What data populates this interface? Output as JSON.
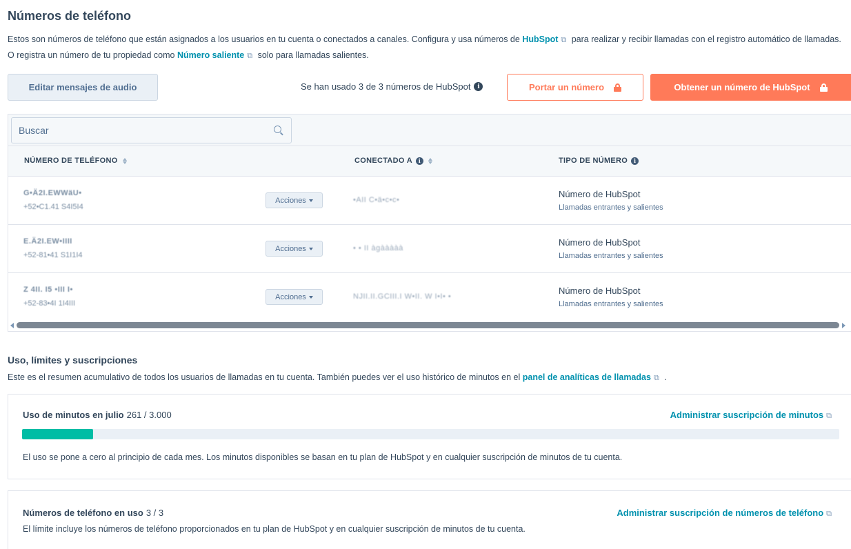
{
  "header": {
    "title": "Números de teléfono",
    "intro_part1": "Estos son números de teléfono que están asignados a los usuarios en tu cuenta o conectados a canales. Configura y usa números de ",
    "intro_link1": "HubSpot",
    "intro_part2": " para realizar y recibir llamadas con el registro automático de llamadas. O registra un número de tu propiedad como ",
    "intro_link2": "Número saliente",
    "intro_part3": " solo para llamadas salientes."
  },
  "toolbar": {
    "edit_audio_label": "Editar mensajes de audio",
    "usage_note": "Se han usado 3 de 3 números de HubSpot",
    "port_number_label": "Portar un número",
    "get_number_label": "Obtener un número de HubSpot"
  },
  "search": {
    "placeholder": "Buscar",
    "value": ""
  },
  "table": {
    "columns": {
      "phone_number": "NÚMERO DE TELÉFONO",
      "connected_to": "CONECTADO A",
      "number_type": "TIPO DE NÚMERO"
    },
    "actions_label": "Acciones",
    "rows": [
      {
        "name": "G•Ä2I.EWWäU•",
        "number": "+52•C1.41 S4I5I4",
        "connected": "•AII C•ä•c•c•",
        "type": "Número de HubSpot",
        "type_sub": "Llamadas entrantes y salientes"
      },
      {
        "name": "E.Ä2I.EW•IIII",
        "number": "+52-81•41 S1I1I4",
        "connected": "• • II àgààààà",
        "type": "Número de HubSpot",
        "type_sub": "Llamadas entrantes y salientes"
      },
      {
        "name": "Z 4II. I5 •III I•",
        "number": "+52-83•4I 1I4III",
        "connected": "NJII.II.GCIII.I W•II. W I•I• •",
        "type": "Número de HubSpot",
        "type_sub": "Llamadas entrantes y salientes"
      }
    ]
  },
  "usage_section": {
    "title": "Uso, límites y suscripciones",
    "desc_part1": "Este es el resumen acumulativo de todos los usuarios de llamadas en tu cuenta. También puedes ver el uso histórico de minutos en el ",
    "desc_link": "panel de analíticas de llamadas",
    "desc_part2": " ."
  },
  "minutes_card": {
    "label": "Uso de minutos en julio",
    "count": "261 / 3.000",
    "used": 261,
    "total": 3000,
    "manage_link": "Administrar suscripción de minutos",
    "note": "El uso se pone a cero al principio de cada mes. Los minutos disponibles se basan en tu plan de HubSpot y en cualquier suscripción de minutos de tu cuenta."
  },
  "numbers_card": {
    "label": "Números de teléfono en uso",
    "count": "3 / 3",
    "manage_link": "Administrar suscripción de números de teléfono",
    "note": "El límite incluye los números de teléfono proporcionados en tu plan de HubSpot y en cualquier suscripción de minutos de tu cuenta."
  },
  "icons": {
    "external": "external-link-icon",
    "info": "info-icon",
    "lock": "lock-icon",
    "search": "search-icon",
    "sort": "sort-icon",
    "caret": "caret-down-icon"
  },
  "colors": {
    "accent": "#ff7a59",
    "link": "#0091ae",
    "progress": "#00bda5",
    "text": "#33475b"
  }
}
